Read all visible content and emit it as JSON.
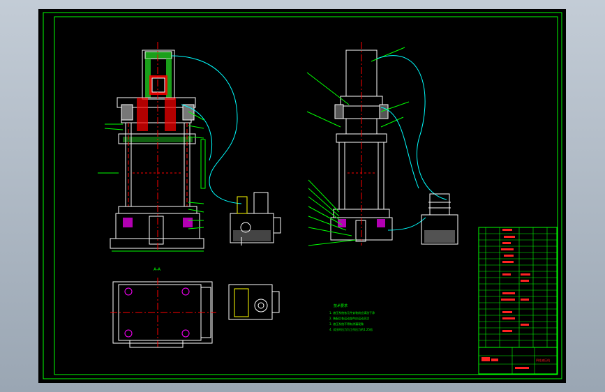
{
  "drawing": {
    "section_label": "A-A",
    "notes_title": "技术要求",
    "notes": [
      "1. 液压系统各元件安装前应清洗干净",
      "2. 装配后各运动部件应运动灵活",
      "3. 液压系统不得有渗漏现象",
      "4. 试压时压力为工作压力的1.25倍"
    ],
    "title_block_name": "四柱液压机"
  },
  "colors": {
    "background": "#000000",
    "frame": "#00ff00",
    "outline": "#ffffff",
    "hatch": "#ff0000",
    "leader": "#00ffff",
    "accent": "#ff00ff"
  },
  "icons": {
    "motor": "motor-icon",
    "pump": "pump-icon"
  }
}
